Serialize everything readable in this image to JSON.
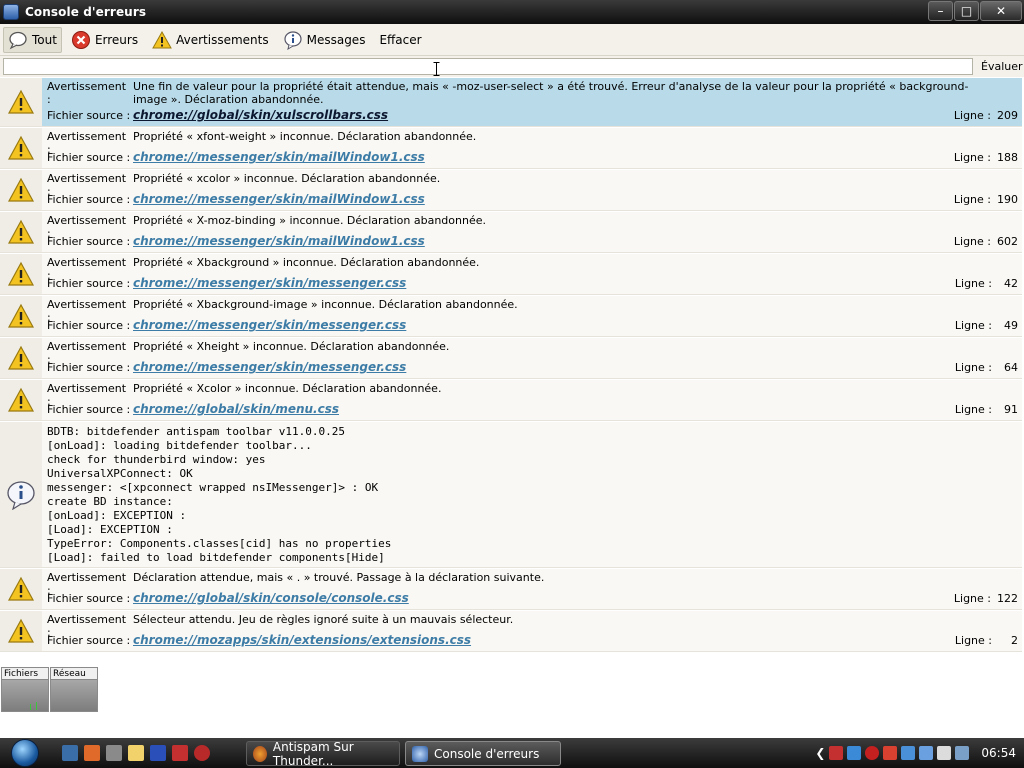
{
  "window": {
    "title": "Console d'erreurs"
  },
  "toolbar": {
    "buttons": [
      {
        "label": "Tout",
        "icon": "all-icon",
        "active": true
      },
      {
        "label": "Erreurs",
        "icon": "error-icon",
        "active": false
      },
      {
        "label": "Avertissements",
        "icon": "warning-icon",
        "active": false
      },
      {
        "label": "Messages",
        "icon": "info-icon",
        "active": false
      },
      {
        "label": "Effacer",
        "icon": "",
        "active": false
      }
    ]
  },
  "evaluate": {
    "value": "",
    "button_label": "Évaluer"
  },
  "labels": {
    "warning": "Avertissement :",
    "source": "Fichier source :",
    "line": "Ligne :"
  },
  "messages": [
    {
      "type": "warning",
      "selected": true,
      "text": "Une fin de valeur pour la propriété était attendue, mais « -moz-user-select » a été trouvé. Erreur d'analyse de la valeur pour la propriété « background-image ». Déclaration abandonnée.",
      "source": "chrome://global/skin/xulscrollbars.css",
      "line": "209"
    },
    {
      "type": "warning",
      "text": "Propriété « xfont-weight » inconnue. Déclaration abandonnée.",
      "source": "chrome://messenger/skin/mailWindow1.css",
      "line": "188"
    },
    {
      "type": "warning",
      "text": "Propriété « xcolor » inconnue. Déclaration abandonnée.",
      "source": "chrome://messenger/skin/mailWindow1.css",
      "line": "190"
    },
    {
      "type": "warning",
      "text": "Propriété « X-moz-binding » inconnue. Déclaration abandonnée.",
      "source": "chrome://messenger/skin/mailWindow1.css",
      "line": "602"
    },
    {
      "type": "warning",
      "text": "Propriété « Xbackground » inconnue. Déclaration abandonnée.",
      "source": "chrome://messenger/skin/messenger.css",
      "line": "42"
    },
    {
      "type": "warning",
      "text": "Propriété « Xbackground-image » inconnue. Déclaration abandonnée.",
      "source": "chrome://messenger/skin/messenger.css",
      "line": "49"
    },
    {
      "type": "warning",
      "text": "Propriété « Xheight » inconnue. Déclaration abandonnée.",
      "source": "chrome://messenger/skin/messenger.css",
      "line": "64"
    },
    {
      "type": "warning",
      "text": "Propriété « Xcolor » inconnue. Déclaration abandonnée.",
      "source": "chrome://global/skin/menu.css",
      "line": "91"
    },
    {
      "type": "info",
      "lines": [
        "BDTB: bitdefender antispam toolbar v11.0.0.25",
        "[onLoad]: loading bitdefender toolbar...",
        "check for thunderbird window: yes",
        "UniversalXPConnect: OK",
        "messenger: <[xpconnect wrapped nsIMessenger]> : OK",
        "create BD instance:",
        "[onLoad]: EXCEPTION :",
        "[Load]: EXCEPTION :",
        "TypeError: Components.classes[cid] has no properties",
        "[Load]: failed to load bitdefender components[Hide]"
      ]
    },
    {
      "type": "warning",
      "text": "Déclaration attendue, mais « . » trouvé. Passage à la déclaration suivante.",
      "source": "chrome://global/skin/console/console.css",
      "line": "122"
    },
    {
      "type": "warning",
      "text": "Sélecteur attendu. Jeu de règles ignoré suite à un mauvais sélecteur.",
      "source": "chrome://mozapps/skin/extensions/extensions.css",
      "line": "2"
    }
  ],
  "gadgets": [
    {
      "label": "Fichiers"
    },
    {
      "label": "Réseau"
    }
  ],
  "taskbar": {
    "tasks": [
      {
        "label": "Antispam Sur Thunder...",
        "active": false
      },
      {
        "label": "Console d'erreurs",
        "active": true
      }
    ],
    "clock": "06:54"
  }
}
